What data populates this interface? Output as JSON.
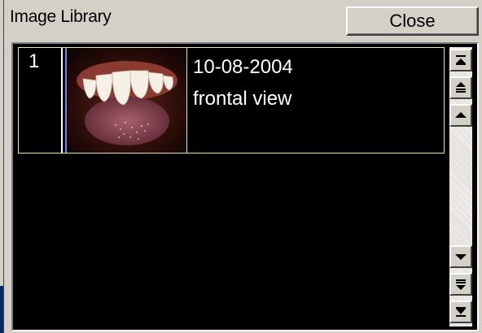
{
  "window": {
    "title": "Image Library",
    "close_label": "Close"
  },
  "library": {
    "items": [
      {
        "index": "1",
        "date": "10-08-2004",
        "caption": "frontal view"
      }
    ]
  },
  "scrollbar": {
    "buttons": [
      "scroll-first-icon",
      "scroll-page-up-icon",
      "scroll-up-icon",
      "scroll-down-icon",
      "scroll-page-down-icon",
      "scroll-last-icon"
    ]
  },
  "colors": {
    "list_bg": "#000000",
    "row_border": "#e8e6a0",
    "window_bg": "#d4d0c8"
  }
}
